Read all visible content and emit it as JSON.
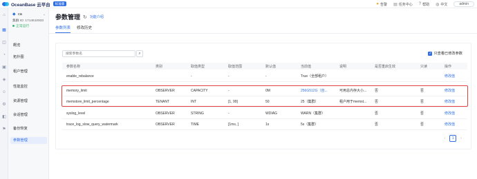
{
  "topbar": {
    "brand": "OceanBase 云平台",
    "brand_tag": "标准版",
    "items": [
      "告警",
      "任务中心",
      "帮助",
      "中文"
    ],
    "admin": "admin"
  },
  "cluster": {
    "name": "ca",
    "id": "集群 ID: 1714610933",
    "status": "正常运行"
  },
  "subnav": [
    "概览",
    "拓扑图",
    "租户管理",
    "性能监控",
    "资源管理",
    "会话管理",
    "备份恢复",
    "参数管理"
  ],
  "main": {
    "title": "参数管理",
    "feedback": "功能介绍",
    "tabs": [
      "参数列表",
      "修改历史"
    ],
    "search_placeholder": "搜索参数名",
    "only_modified": "只查看已修改参数"
  },
  "table": {
    "headers": [
      "参数名称",
      "类别",
      "取值类型",
      "取值范围",
      "默认值",
      "当前值",
      "说明",
      "是否重启生效",
      "只读",
      "操作"
    ],
    "rows": [
      [
        "enable_rebalance",
        "",
        "-",
        "-",
        "-",
        "True（全部租户）",
        "",
        "",
        "",
        "修改值"
      ],
      [
        "memory_limit",
        "OBSERVER",
        "CAPACITY",
        "-",
        "0M",
        "256G512G（自...",
        "可用总内存大小...",
        "否",
        "否",
        "修改值"
      ],
      [
        "memstore_limit_percentage",
        "TENANT",
        "INT",
        "[1, 99]",
        "50",
        "25（集群）",
        "租户用于memst...",
        "否",
        "否",
        "修改值"
      ],
      [
        "syslog_level",
        "OBSERVER",
        "STRING",
        "-",
        "WDIAG",
        "WARN（集群）",
        "",
        "否",
        "否",
        "修改值"
      ],
      [
        "trace_log_slow_query_watermark",
        "OBSERVER",
        "TIME",
        "[1ms, ]",
        "1s",
        "5s（集群）",
        "",
        "否",
        "否",
        "修改值"
      ]
    ]
  },
  "pagination": {
    "prev": "‹",
    "current": "1",
    "next": "›"
  },
  "colors": {
    "accent": "#2f6fe4",
    "highlight": "#e04040"
  }
}
